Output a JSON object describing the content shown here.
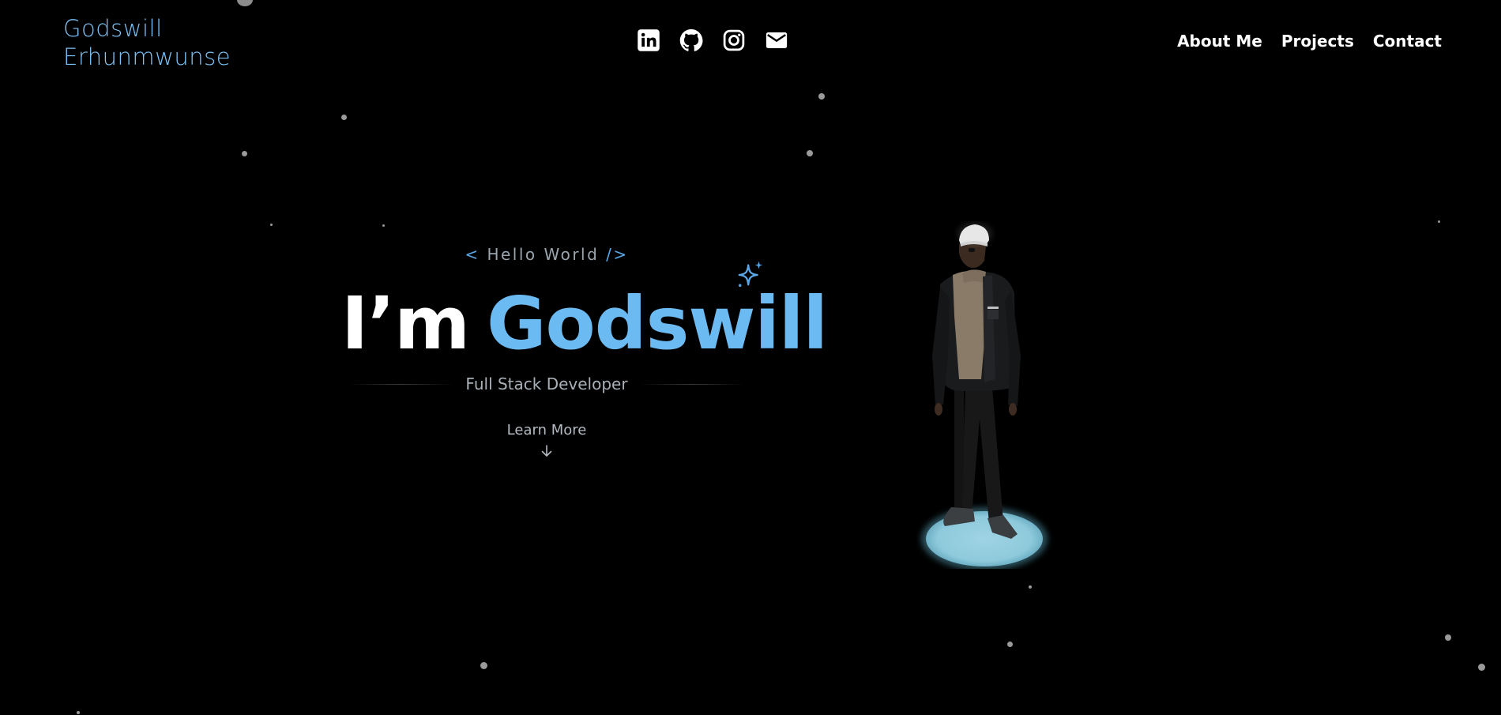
{
  "header": {
    "brand_line1": "Godswill",
    "brand_line2": "Erhunmwunse",
    "socials": [
      {
        "name": "linkedin",
        "icon": "linkedin-icon"
      },
      {
        "name": "github",
        "icon": "github-icon"
      },
      {
        "name": "instagram",
        "icon": "instagram-icon"
      },
      {
        "name": "email",
        "icon": "mail-icon"
      }
    ],
    "nav": {
      "about": "About Me",
      "projects": "Projects",
      "contact": "Contact"
    }
  },
  "hero": {
    "tag_open": "< ",
    "tag_text": "Hello World",
    "tag_close": " />",
    "greeting": "I’m",
    "name": "Godswill",
    "subtitle": "Full Stack Developer",
    "cta": "Learn More"
  },
  "colors": {
    "background": "#000000",
    "accent": "#6cbaf2",
    "brand": "#7cc0f4",
    "platform": "#9fd3e3"
  }
}
